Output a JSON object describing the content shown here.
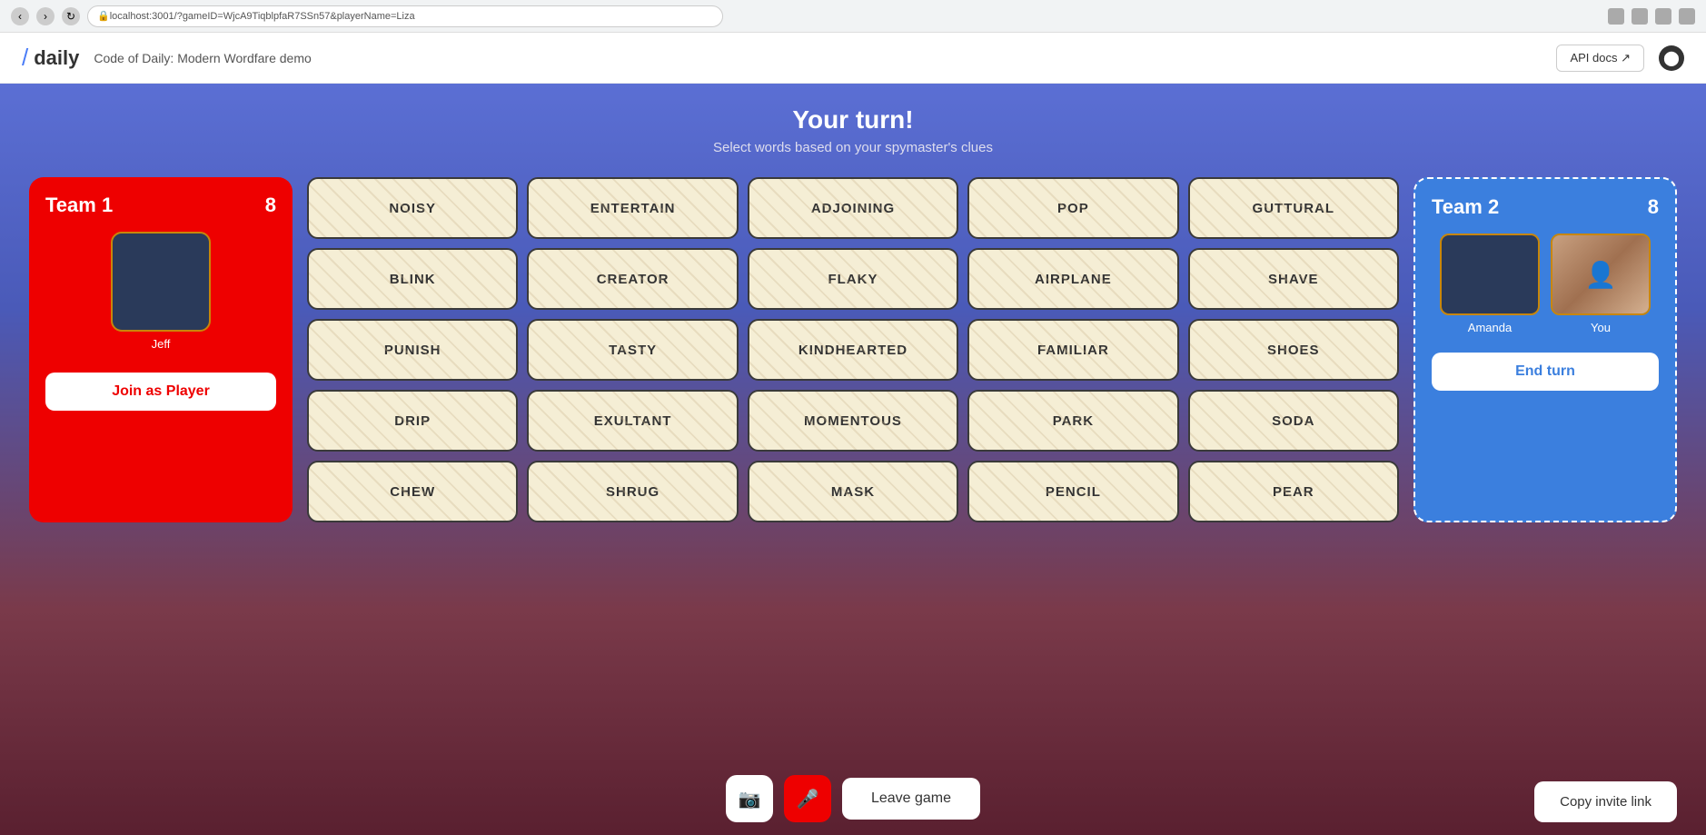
{
  "browser": {
    "url": "localhost:3001/?gameID=WjcA9TiqblpfaR7SSn57&playerName=Liza"
  },
  "header": {
    "logo_slash": "/",
    "logo_text": "daily",
    "app_title": "Code of Daily: Modern Wordfare demo",
    "api_docs_label": "API docs ↗",
    "github_icon": "🐙"
  },
  "turn": {
    "title": "Your turn!",
    "subtitle": "Select words based on your spymaster's clues"
  },
  "team1": {
    "name": "Team 1",
    "score": "8",
    "player_name": "Jeff",
    "join_btn_label": "Join as Player"
  },
  "team2": {
    "name": "Team 2",
    "score": "8",
    "player1_name": "Amanda",
    "player2_name": "You",
    "end_turn_label": "End turn"
  },
  "words": [
    "NOISY",
    "ENTERTAIN",
    "ADJOINING",
    "POP",
    "GUTTURAL",
    "BLINK",
    "CREATOR",
    "FLAKY",
    "AIRPLANE",
    "SHAVE",
    "PUNISH",
    "TASTY",
    "KINDHEARTED",
    "FAMILIAR",
    "SHOES",
    "DRIP",
    "EXULTANT",
    "MOMENTOUS",
    "PARK",
    "SODA",
    "CHEW",
    "SHRUG",
    "MASK",
    "PENCIL",
    "PEAR"
  ],
  "controls": {
    "camera_icon": "📷",
    "mic_off_icon": "🎤",
    "leave_label": "Leave game",
    "copy_invite_label": "Copy invite link"
  }
}
